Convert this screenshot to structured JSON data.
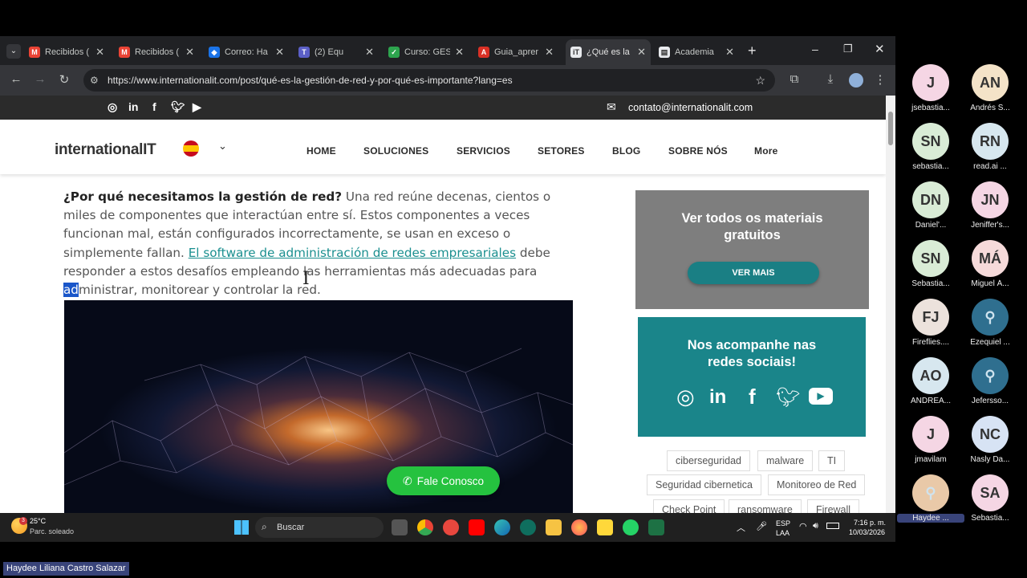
{
  "tabs": [
    {
      "title": "Recibidos (",
      "icon": "gmail-icon",
      "color": "#ea4335",
      "fav": "M"
    },
    {
      "title": "Recibidos (",
      "icon": "gmail-icon",
      "color": "#ea4335",
      "fav": "M"
    },
    {
      "title": "Correo: Ha",
      "icon": "outlook-icon",
      "color": "#1a73e8",
      "fav": "◆"
    },
    {
      "title": "(2) Equ",
      "icon": "teams-icon",
      "color": "#5b5fc7",
      "fav": "T"
    },
    {
      "title": "Curso: GES",
      "icon": "course-icon",
      "color": "#2da44e",
      "fav": "✓"
    },
    {
      "title": "Guia_aprer",
      "icon": "pdf-icon",
      "color": "#d93025",
      "fav": "A"
    },
    {
      "title": "¿Qué es la",
      "icon": "internationalit-icon",
      "color": "#e8eaed",
      "fav": "iT"
    },
    {
      "title": "Academia",
      "icon": "academia-icon",
      "color": "#e8eaed",
      "fav": "▤"
    }
  ],
  "url": "https://www.internationalit.com/post/qué-es-la-gestión-de-red-y-por-qué-es-importante?lang=es",
  "site": {
    "email": "contato@internationalit.com",
    "logo": "internationalIT",
    "nav": [
      "HOME",
      "SOLUCIONES",
      "SERVICIOS",
      "SETORES",
      "BLOG",
      "SOBRE NÓS",
      "More"
    ]
  },
  "article": {
    "bold": "¿Por qué necesitamos la gestión de red?",
    "p1": " Una red reúne decenas, cientos o miles de componentes que interactúan entre sí. Estos componentes a veces funcionan mal, están configurados incorrectamente, se usan en exceso o simplemente fallan. ",
    "link": "El software de administración de redes empresariales",
    "p2": " debe responder a estos desafíos empleando las herramientas más adecuadas para ",
    "selected": "ad",
    "p3": "ministrar, monitorear y controlar la red."
  },
  "fale_label": "Fale Conosco",
  "sidebar": {
    "materials_title": "Ver todos os materiais gratuitos",
    "materials_button": "VER MAIS",
    "social_title": "Nos acompanhe nas redes sociais!",
    "tags": [
      "ciberseguridad",
      "malware",
      "TI",
      "Seguridad cibernetica",
      "Monitoreo de Red",
      "Check Point",
      "ransomware",
      "Firewall"
    ]
  },
  "taskbar": {
    "weather_temp": "25°C",
    "weather_desc": "Parc. soleado",
    "search_label": "Buscar",
    "lang1": "ESP",
    "lang2": "LAA",
    "time": "7:16 p. m.",
    "date": "10/03/2026",
    "badge": "3"
  },
  "participants": [
    {
      "initials": "J",
      "name": "jsebastia...",
      "bg": "#f5d6e4"
    },
    {
      "initials": "AN",
      "name": "Andrés S...",
      "bg": "#f4e3c8"
    },
    {
      "initials": "SN",
      "name": "sebastia...",
      "bg": "#d9ecd6"
    },
    {
      "initials": "RN",
      "name": "read.ai ...",
      "bg": "#d7e7ef"
    },
    {
      "initials": "DN",
      "name": "Daniel'...",
      "bg": "#d9ecd6"
    },
    {
      "initials": "JN",
      "name": "Jeniffer's...",
      "bg": "#f5d6e4"
    },
    {
      "initials": "SN",
      "name": "Sebastia...",
      "bg": "#d9ecd6"
    },
    {
      "initials": "MÁ",
      "name": "Miguel Á...",
      "bg": "#f6dada"
    },
    {
      "initials": "FJ",
      "name": "Fireflies....",
      "bg": "#ece2dc"
    },
    {
      "initials": "",
      "name": "Ezequiel ...",
      "bg": "#2f6f8f"
    },
    {
      "initials": "AO",
      "name": "ANDREA...",
      "bg": "#d7e7ef"
    },
    {
      "initials": "",
      "name": "Jefersso...",
      "bg": "#2f6f8f"
    },
    {
      "initials": "J",
      "name": "jmavilam",
      "bg": "#f5d6e4"
    },
    {
      "initials": "NC",
      "name": "Nasly Da...",
      "bg": "#d7e3f4"
    },
    {
      "initials": "",
      "name": "Haydee ...",
      "bg": "#e9c9a8"
    },
    {
      "initials": "SA",
      "name": "Sebastia...",
      "bg": "#f5d6e4"
    }
  ],
  "presenter_name": "Haydee Liliana Castro Salazar"
}
